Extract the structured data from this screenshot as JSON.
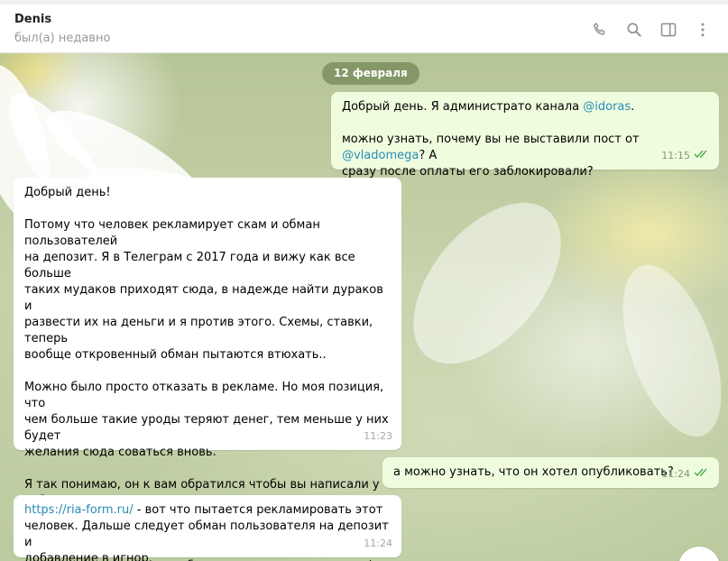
{
  "header": {
    "peer_name": "Denis",
    "peer_status": "был(а) недавно",
    "icons": [
      "phone-icon",
      "search-icon",
      "sidebar-toggle-icon",
      "more-vertical-icon"
    ]
  },
  "date_separator": "12 февраля",
  "messages": [
    {
      "direction": "out",
      "parts": [
        {
          "t": "Добрый день. Я администрато канала "
        },
        {
          "link": "@idoras"
        },
        {
          "t": ".\n\nможно узнать, почему вы не выставили пост от "
        },
        {
          "link": "@vladomega"
        },
        {
          "t": "? А\nсразу после оплаты его заблокировали?"
        }
      ],
      "time": "11:15",
      "read": true
    },
    {
      "direction": "in",
      "text": "Добрый день!\n\nПотому что человек рекламирует скам и обман пользователей\nна депозит. Я в Телеграм с 2017 года и вижу как все больше\nтаких мудаков приходят сюда, в надежде найти дураков и\nразвести их на деньги и я против этого. Схемы, ставки, теперь\nвообще откровенный обман пытаются втюхать..\n\nМожно было просто отказать в рекламе. Но моя позиция, что\nчем больше такие уроды теряют денег, тем меньше у них будет\nжелания сюда соваться вновь.\n\nЯ так понимаю, он к вам обратился чтобы вы написали у себя в\nканале какой я плохой - взял с мошенника деньги и не выставил\nего обманный пост. Да, все так и было, если считаете это\nнеправильным - можете об этом написать, я не против)",
      "time": "11:23"
    },
    {
      "direction": "out",
      "text": "а можно узнать, что он хотел опубликовать?",
      "time": "11:24",
      "read": true
    },
    {
      "direction": "in",
      "link": "https://ria-form.ru/",
      "text": " - вот что пытается рекламировать этот\nчеловек. Дальше следует обман пользователя на депозит и\nдобавление в игнор.",
      "time": "11:24"
    }
  ],
  "colors": {
    "outgoing_bubble": "#effdde",
    "incoming_bubble": "#ffffff",
    "link": "#2a8ab8",
    "read_check": "#4fae4e"
  }
}
